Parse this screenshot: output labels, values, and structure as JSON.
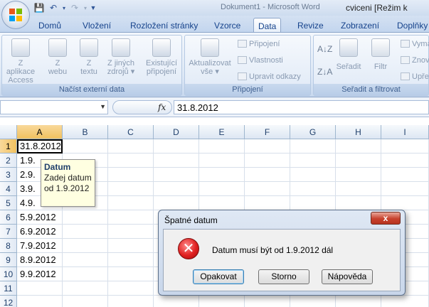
{
  "window": {
    "title_faded": "Dokument1 - Microsoft Word",
    "title_main": "cviceni  [Režim k"
  },
  "tabs": [
    {
      "label": "Domů"
    },
    {
      "label": "Vložení"
    },
    {
      "label": "Rozložení stránky"
    },
    {
      "label": "Vzorce"
    },
    {
      "label": "Data"
    },
    {
      "label": "Revize"
    },
    {
      "label": "Zobrazení"
    },
    {
      "label": "Doplňky"
    }
  ],
  "ribbon": {
    "groups": {
      "external": {
        "label": "Načíst externí data",
        "buttons": [
          {
            "line1": "Z aplikace",
            "line2": "Access"
          },
          {
            "line1": "Z",
            "line2": "webu"
          },
          {
            "line1": "Z",
            "line2": "textu"
          },
          {
            "line1": "Z jiných",
            "line2": "zdrojů ▾"
          },
          {
            "line1": "Existující",
            "line2": "připojení"
          }
        ]
      },
      "connections": {
        "label": "Připojení",
        "refresh": {
          "line1": "Aktualizovat",
          "line2": "vše ▾"
        },
        "small": [
          "Připojení",
          "Vlastnosti",
          "Upravit odkazy"
        ]
      },
      "sort": {
        "label": "Seřadit a filtrovat",
        "sort_label": "Seřadit",
        "filter_label": "Filtr",
        "small": [
          "Vymaz",
          "Znovu",
          "Upře"
        ]
      }
    }
  },
  "formula_bar": {
    "name_box": "",
    "fx": "fx",
    "value": "31.8.2012"
  },
  "grid": {
    "columns": [
      "A",
      "B",
      "C",
      "D",
      "E",
      "F",
      "G",
      "H",
      "I"
    ],
    "rows": [
      "1",
      "2",
      "3",
      "4",
      "5",
      "6",
      "7",
      "8",
      "9",
      "10",
      "11",
      "12"
    ],
    "col_a_values": [
      "31.8.2012",
      "1.9.",
      "2.9.",
      "3.9.",
      "4.9.",
      "5.9.2012",
      "6.9.2012",
      "7.9.2012",
      "8.9.2012",
      "9.9.2012",
      "",
      ""
    ]
  },
  "tooltip": {
    "title": "Datum",
    "line1": "Zadej datum",
    "line2": "od 1.9.2012"
  },
  "dialog": {
    "title": "Špatné datum",
    "close": "x",
    "message": "Datum musí být od 1.9.2012 dál",
    "buttons": {
      "retry": "Opakovat",
      "cancel": "Storno",
      "help": "Nápověda"
    }
  }
}
